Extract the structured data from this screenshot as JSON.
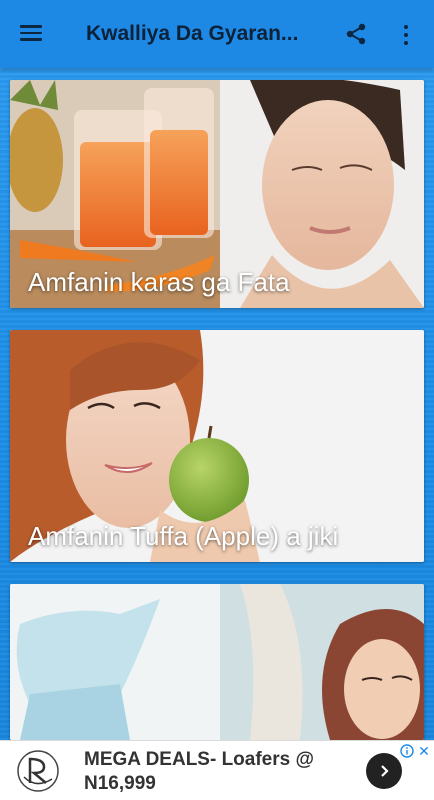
{
  "app_bar": {
    "title": "Kwalliya Da Gyaran...",
    "menu_icon": "hamburger-menu-icon",
    "share_icon": "share-icon",
    "more_icon": "more-vertical-icon"
  },
  "cards": [
    {
      "caption": "Amfanin karas ga Fata",
      "image": "carrot-juice-and-woman-face-photo"
    },
    {
      "caption": "Amfanin Tuffa (Apple) a jiki",
      "image": "woman-with-green-apple-photo"
    },
    {
      "caption": "",
      "image": "facial-steamer-illustration"
    }
  ],
  "ad": {
    "text": "MEGA DEALS- Loafers @ N16,999",
    "info_icon": "ad-info-icon",
    "close_icon": "ad-close-icon",
    "arrow_icon": "chevron-right-icon"
  },
  "colors": {
    "app_bar": "#1e88e5",
    "background": "#1f8fe0",
    "title_text": "#0b2238",
    "caption_text": "#ffffff"
  }
}
